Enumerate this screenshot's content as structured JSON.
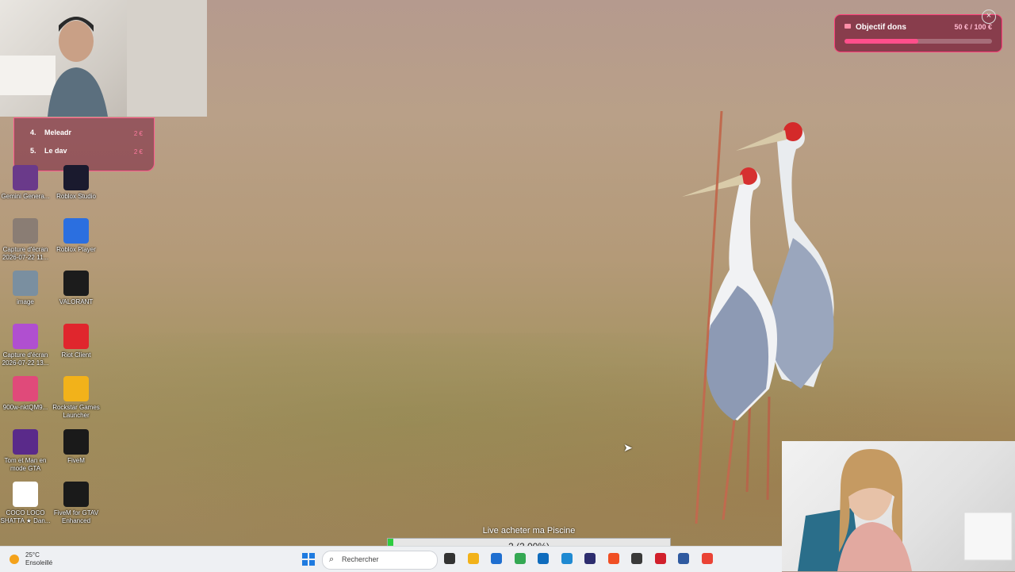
{
  "overlay": {
    "goal": {
      "title": "Objectif dons",
      "amount": "50 € / 100 €",
      "progress": 0.5
    },
    "donors": [
      {
        "rank": "4.",
        "name": "Meleadr",
        "amount": "2 €"
      },
      {
        "rank": "5.",
        "name": "Le dav",
        "amount": "2 €"
      }
    ],
    "live_goal": {
      "title": "Live acheter ma Piscine",
      "value": "2 (2.00%)",
      "progress": 0.02
    }
  },
  "desktop_icons": [
    {
      "label": "Gemini Genera...",
      "icon": "image-file-icon",
      "color": "#6a3a8a"
    },
    {
      "label": "Roblox Studio",
      "icon": "roblox-studio-icon",
      "color": "#1a1a2e"
    },
    {
      "label": "Capture d'écran 2026-07-22 11...",
      "icon": "image-file-icon",
      "color": "#8a7d74"
    },
    {
      "label": "Roblox Player",
      "icon": "roblox-player-icon",
      "color": "#2b6fe0"
    },
    {
      "label": "image",
      "icon": "image-file-icon",
      "color": "#7a8fa0"
    },
    {
      "label": "VALORANT",
      "icon": "valorant-icon",
      "color": "#1c1c1c"
    },
    {
      "label": "Capture d'écran 2026-07-22 13...",
      "icon": "image-file-icon",
      "color": "#b04fd0"
    },
    {
      "label": "Riot Client",
      "icon": "riot-client-icon",
      "color": "#e0262d"
    },
    {
      "label": "900w-nktQM9...",
      "icon": "image-file-icon",
      "color": "#e04a7a"
    },
    {
      "label": "Rockstar Games Launcher",
      "icon": "rockstar-icon",
      "color": "#f2b21a"
    },
    {
      "label": "Tom et Man en mode GTA",
      "icon": "image-file-icon",
      "color": "#5a2a8a"
    },
    {
      "label": "FiveM",
      "icon": "fivem-icon",
      "color": "#1a1a1a"
    },
    {
      "label": "COCO LOCO SHATTA ★ Dan...",
      "icon": "video-file-icon",
      "color": "#ffffff"
    },
    {
      "label": "FiveM for GTAV Enhanced",
      "icon": "fivem-icon",
      "color": "#1a1a1a"
    }
  ],
  "taskbar": {
    "weather": {
      "temp": "25°C",
      "condition": "Ensoleillé"
    },
    "search_placeholder": "Rechercher",
    "apps": [
      {
        "name": "taskview-icon",
        "color": "#333333"
      },
      {
        "name": "file-explorer-icon",
        "color": "#f2b21a"
      },
      {
        "name": "store-icon",
        "color": "#1f6fd0"
      },
      {
        "name": "chrome-icon",
        "color": "#34a853"
      },
      {
        "name": "outlook-icon",
        "color": "#0f6cbd"
      },
      {
        "name": "vscode-icon",
        "color": "#1f8ad2"
      },
      {
        "name": "app-icon",
        "color": "#2d2d6e"
      },
      {
        "name": "brave-icon",
        "color": "#f04f24"
      },
      {
        "name": "obs-icon",
        "color": "#3a3a3a"
      },
      {
        "name": "riot-client-icon",
        "color": "#d1202c"
      },
      {
        "name": "app2-icon",
        "color": "#2f5aa0"
      },
      {
        "name": "chrome-icon",
        "color": "#ea4335"
      }
    ]
  }
}
